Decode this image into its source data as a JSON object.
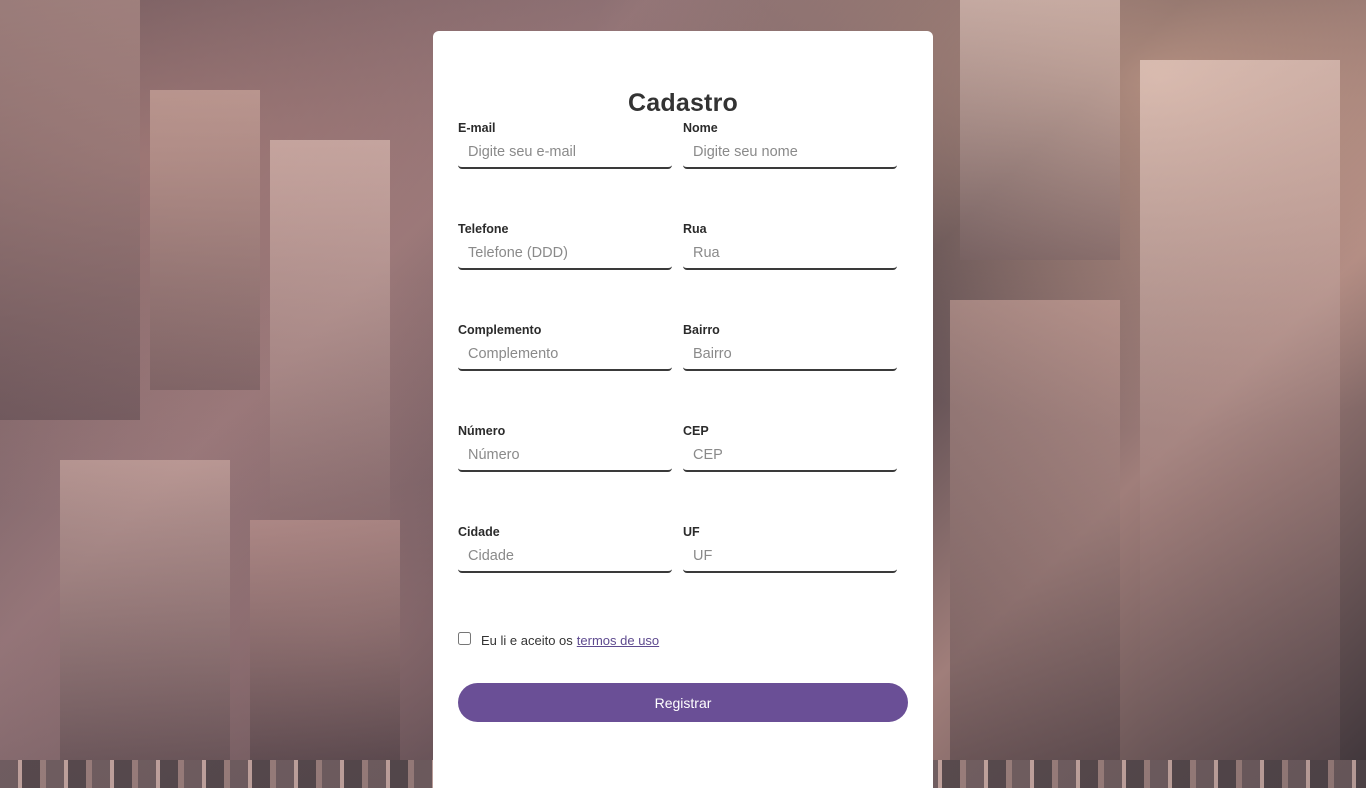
{
  "form": {
    "title": "Cadastro",
    "fields": {
      "email": {
        "label": "E-mail",
        "placeholder": "Digite seu e-mail",
        "value": ""
      },
      "nome": {
        "label": "Nome",
        "placeholder": "Digite seu nome",
        "value": ""
      },
      "telefone": {
        "label": "Telefone",
        "placeholder": "Telefone (DDD)",
        "value": ""
      },
      "rua": {
        "label": "Rua",
        "placeholder": "Rua",
        "value": ""
      },
      "complemento": {
        "label": "Complemento",
        "placeholder": "Complemento",
        "value": ""
      },
      "bairro": {
        "label": "Bairro",
        "placeholder": "Bairro",
        "value": ""
      },
      "numero": {
        "label": "Número",
        "placeholder": "Número",
        "value": ""
      },
      "cep": {
        "label": "CEP",
        "placeholder": "CEP",
        "value": ""
      },
      "cidade": {
        "label": "Cidade",
        "placeholder": "Cidade",
        "value": ""
      },
      "uf": {
        "label": "UF",
        "placeholder": "UF",
        "value": ""
      }
    },
    "terms": {
      "text": "Eu li e aceito os",
      "link_text": "termos de uso",
      "checked": false
    },
    "submit_label": "Registrar"
  },
  "colors": {
    "accent": "#6a4f96",
    "link": "#5e4a8f",
    "card_background": "#ffffff"
  }
}
